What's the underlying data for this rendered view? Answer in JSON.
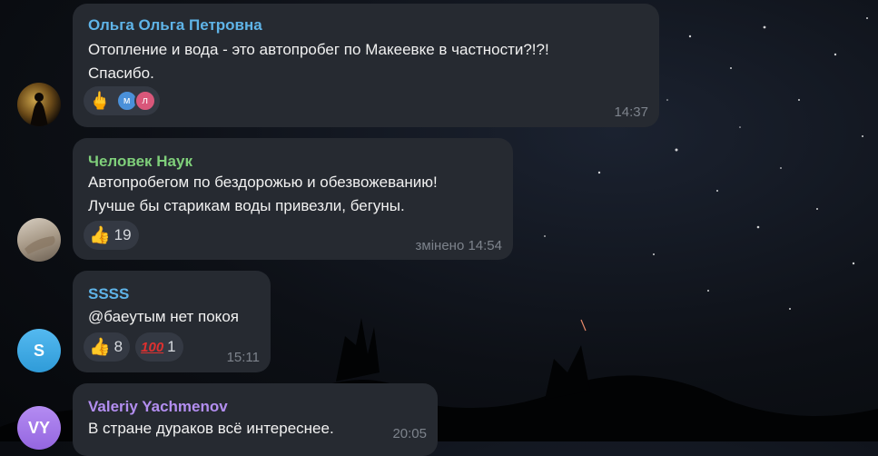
{
  "colors": {
    "name_olga": "#5fb4e8",
    "name_chelovek": "#7fcf7a",
    "name_ssss": "#5fb4e8",
    "name_valeriy": "#b38ef0"
  },
  "messages": [
    {
      "author": "Ольга Ольга Петровна",
      "line1": "Отопление и вода - это автопробег по Макеевке в частности?!?!",
      "line2": "Спасибо.",
      "reaction_icon": "middle-finger-icon",
      "reactor_1": "м",
      "reactor_2": "л",
      "time": "14:37"
    },
    {
      "author": "Человек Наук",
      "line1": "Автопробегом по бездорожью и обезвожеванию!",
      "line2": "Лучше бы старикам воды привезли, бегуны.",
      "reaction_icon": "thumbs-up-icon",
      "reaction_count": "19",
      "time": "змінено 14:54"
    },
    {
      "author": "SSSS",
      "avatar_letter": "S",
      "line1": "@баеутым нет покоя",
      "reaction_1_icon": "thumbs-up-icon",
      "reaction_1_count": "8",
      "reaction_2_icon": "hundred-points-icon",
      "reaction_2_count": "1",
      "time": "15:11"
    },
    {
      "author": "Valeriy Yachmenov",
      "avatar_letters": "VY",
      "line1": "В стране дураков всё интереснее.",
      "time": "20:05"
    }
  ]
}
